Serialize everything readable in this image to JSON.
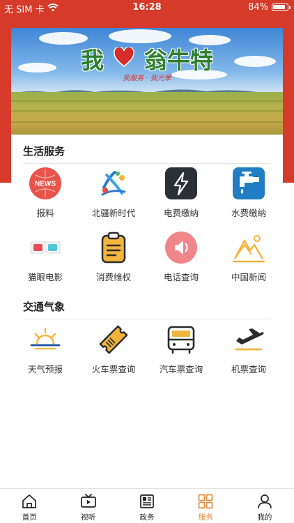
{
  "status_bar": {
    "carrier": "无 SIM 卡",
    "time": "16:28",
    "battery": "84%"
  },
  "banner": {
    "title_left": "我",
    "title_right": "翁牛特",
    "subtitle": "我服务 · 我光荣"
  },
  "sections": {
    "life": {
      "title": "生活服务",
      "items": [
        {
          "label": "报料",
          "icon": "news-icon"
        },
        {
          "label": "北疆新时代",
          "icon": "beijiang-logo-icon"
        },
        {
          "label": "电费缴纳",
          "icon": "lightning-icon"
        },
        {
          "label": "水费缴纳",
          "icon": "water-tap-icon"
        },
        {
          "label": "猫眼电影",
          "icon": "3d-glasses-icon"
        },
        {
          "label": "消费维权",
          "icon": "clipboard-icon"
        },
        {
          "label": "电话查询",
          "icon": "speaker-icon"
        },
        {
          "label": "中国新闻",
          "icon": "mountain-frame-icon"
        }
      ]
    },
    "transport": {
      "title": "交通气象",
      "items": [
        {
          "label": "天气预报",
          "icon": "sunrise-icon"
        },
        {
          "label": "火车票查询",
          "icon": "ticket-icon"
        },
        {
          "label": "汽车票查询",
          "icon": "bus-icon"
        },
        {
          "label": "机票查询",
          "icon": "plane-icon"
        }
      ]
    }
  },
  "tabbar": {
    "tabs": [
      {
        "label": "首页",
        "icon": "home-icon"
      },
      {
        "label": "视听",
        "icon": "tv-play-icon"
      },
      {
        "label": "政务",
        "icon": "newspaper-icon"
      },
      {
        "label": "服务",
        "icon": "grid-icon"
      },
      {
        "label": "我的",
        "icon": "person-icon"
      }
    ],
    "active": "服务"
  },
  "colors": {
    "header_red": "#d63a2a",
    "active_tab": "#e08a3c",
    "accent_yellow": "#f2b43c"
  }
}
